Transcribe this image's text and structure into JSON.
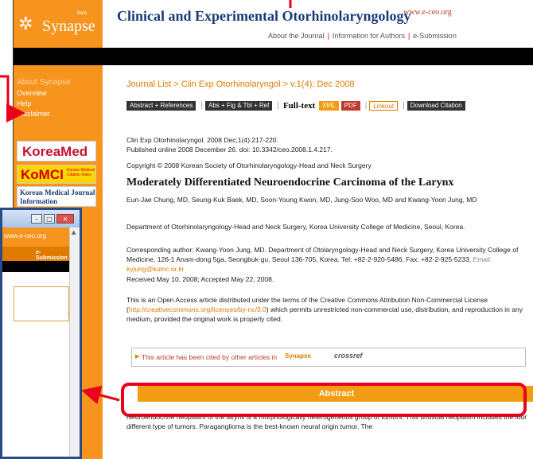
{
  "header": {
    "logo_word": "Synapse",
    "logo_small": "Beta",
    "site_title": "Clinical and Experimental Otorhinolaryngology",
    "site_url": "www.e-ceo.org",
    "nav": [
      "About the Journal",
      "Information for Authors",
      "e-Submission"
    ]
  },
  "sidebar": {
    "heading": "About Synapse",
    "items": [
      "Overview",
      "Help",
      "Disclaimer"
    ],
    "logos": {
      "koreamed": "KoreaMed",
      "kamje": "KoMCI",
      "kamje_small": "Korean Medical Citation Index",
      "kmji": "Korean Medical Journal Information"
    }
  },
  "breadcrumb": "Journal List > Clin Exp Otorhinolaryngol > v.1(4); Dec 2008",
  "tabs": {
    "abstract_refs": "Abstract + References",
    "abs_fig_tbl_ref": "Abs + Fig & Tbl + Ref",
    "fulltext": "Full-text",
    "xml": "XML",
    "pdf": "PDF",
    "linkout": "Linkout",
    "download": "Download Citation"
  },
  "article": {
    "citation": "Clin Exp Otorhinolaryngol. 2008 Dec;1(4):217-220.",
    "published": "Published online 2008 December 26.  doi: 10.3342/ceo.2008.1.4.217.",
    "copyright": "Copyright © 2008 Korean Society of Otorhinolaryngology-Head and Neck Surgery",
    "title": "Moderately Differentiated Neuroendocrine Carcinoma of the Larynx",
    "authors": "Eun-Jae Chung, MD, Seung-Kuk Baek, MD, Soon-Young Kwon, MD, Jung-Soo Woo, MD and Kwang-Yoon Jung, MD",
    "department": "Department of Otorhinolaryngology-Head and Neck Surgery, Korea University College of Medicine, Seoul, Korea.",
    "corresponding": "Corresponding author: Kwang-Yoon Jung, MD. Department of Otolaryngology-Head and Neck Surgery, Korea University College of Medicine, 126-1 Anam-dong 5ga, Seongbuk-gu, Seoul 136-705, Korea. Tel: +82-2-920-5486, Fax: +82-2-925-5233,",
    "email_label": "Email:",
    "email": "kyjung@kumc.or.kr",
    "received": "Received May 10, 2008; Accepted May 22, 2008.",
    "license_pre": "This is an Open Access article distributed under the terms of the Creative Commons Attribution Non-Commercial License (",
    "license_url": "http://creativecommons.org/licenses/by-nc/3.0",
    "license_post": ") which permits unrestricted non-commercial use, distribution, and reproduction in any medium, provided the original work is properly cited.",
    "cited_by": "This article has been cited by other articles in",
    "cited_badge1": "Synapse",
    "cited_badge2": "crossref",
    "abstract_heading": "Abstract",
    "abstract_text": "Neuroendocrine neoplasm of the larynx is a morphologically heterogeneous group of tumors. This unusual neoplasm includes the four different type of tumors. Paraganglioma is the best-known neural origin tumor. The"
  },
  "popup": {
    "url": "www.e-ceo.org",
    "nav": "e-Submission"
  },
  "colors": {
    "orange": "#f7941d",
    "annotation_red": "#e8001c",
    "navy": "#1a3a7a"
  }
}
